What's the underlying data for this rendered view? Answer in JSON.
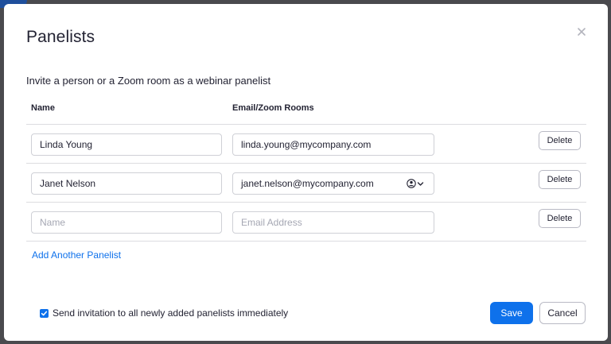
{
  "dialog": {
    "title": "Panelists",
    "intro": "Invite a person or a Zoom room as a webinar panelist"
  },
  "table": {
    "headers": {
      "name": "Name",
      "email": "Email/Zoom Rooms"
    },
    "rows": [
      {
        "name": "Linda Young",
        "email": "linda.young@mycompany.com",
        "delete_label": "Delete"
      },
      {
        "name": "Janet Nelson",
        "email": "janet.nelson@mycompany.com",
        "delete_label": "Delete",
        "has_contact_picker": true
      },
      {
        "name": "",
        "email": "",
        "delete_label": "Delete"
      }
    ],
    "placeholders": {
      "name": "Name",
      "email": "Email Address"
    }
  },
  "add_link": "Add Another Panelist",
  "footer": {
    "checkbox_label": "Send invitation to all newly added panelists immediately",
    "checkbox_checked": true,
    "save_label": "Save",
    "cancel_label": "Cancel"
  },
  "colors": {
    "accent": "#0e71eb",
    "text": "#232333",
    "border": "#cfd0d6",
    "backdrop": "#4a4a4e"
  },
  "icons": {
    "close": "close-icon",
    "contact_picker": "person-icon",
    "dropdown": "chevron-down-icon",
    "check": "checkmark-icon"
  }
}
